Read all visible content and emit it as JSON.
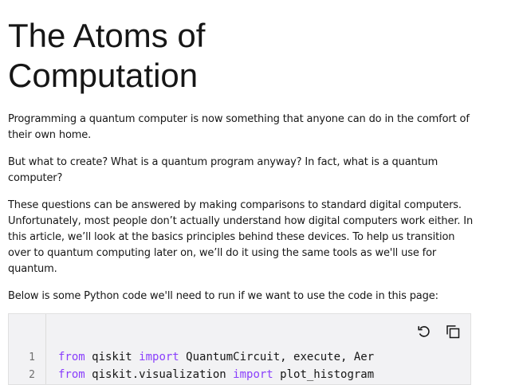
{
  "article": {
    "title": "The Atoms of Computation",
    "paragraphs": [
      "Programming a quantum computer is now something that anyone can do in the comfort of their own home.",
      "But what to create? What is a quantum program anyway? In fact, what is a quantum computer?",
      "These questions can be answered by making comparisons to standard digital computers. Unfortunately, most people don’t actually understand how digital computers work either. In this article, we’ll look at the basics principles behind these devices. To help us transition over to quantum computing later on, we’ll do it using the same tools as we'll use for quantum.",
      "Below is some Python code we'll need to run if we want to use the code in this page:"
    ]
  },
  "code_cell": {
    "line_numbers": [
      "1",
      "2"
    ],
    "lines": [
      {
        "kw1": "from",
        "mod": " qiskit ",
        "kw2": "import",
        "rest": " QuantumCircuit, execute, Aer"
      },
      {
        "kw1": "from",
        "mod": " qiskit.visualization ",
        "kw2": "import",
        "rest": " plot_histogram"
      }
    ],
    "icons": {
      "reset": "reset-icon",
      "copy": "copy-icon"
    }
  },
  "colors": {
    "keyword": "#8a3ffc",
    "text": "#161616",
    "code_bg": "#f2f2f4"
  }
}
